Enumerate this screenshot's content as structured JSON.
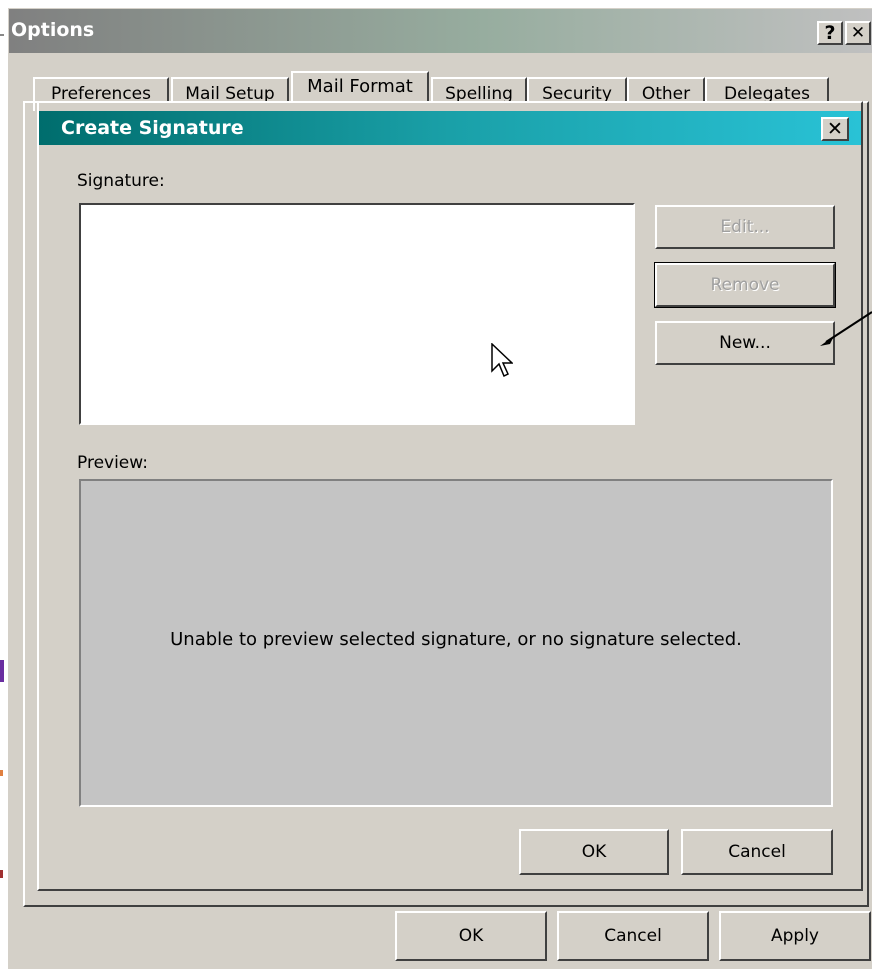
{
  "options_window": {
    "title": "Options",
    "help_label": "?",
    "close_label": "✕",
    "tabs": [
      {
        "label": "Preferences"
      },
      {
        "label": "Mail Setup"
      },
      {
        "label": "Mail Format",
        "active": true
      },
      {
        "label": "Spelling"
      },
      {
        "label": "Security"
      },
      {
        "label": "Other"
      },
      {
        "label": "Delegates"
      }
    ],
    "buttons": {
      "ok": "OK",
      "cancel": "Cancel",
      "apply": "Apply"
    }
  },
  "signature_dialog": {
    "title": "Create Signature",
    "close_label": "✕",
    "signature_label": "Signature:",
    "preview_label": "Preview:",
    "preview_message": "Unable to preview selected signature, or no signature selected.",
    "buttons": {
      "edit": "Edit...",
      "remove": "Remove",
      "new": "New...",
      "ok": "OK",
      "cancel": "Cancel"
    }
  },
  "colors": {
    "dialog_face": "#d4d0c8",
    "options_title_gradient_start": "#808080",
    "signature_title_gradient_start": "#006d6d",
    "signature_title_gradient_end": "#29c2d6"
  }
}
